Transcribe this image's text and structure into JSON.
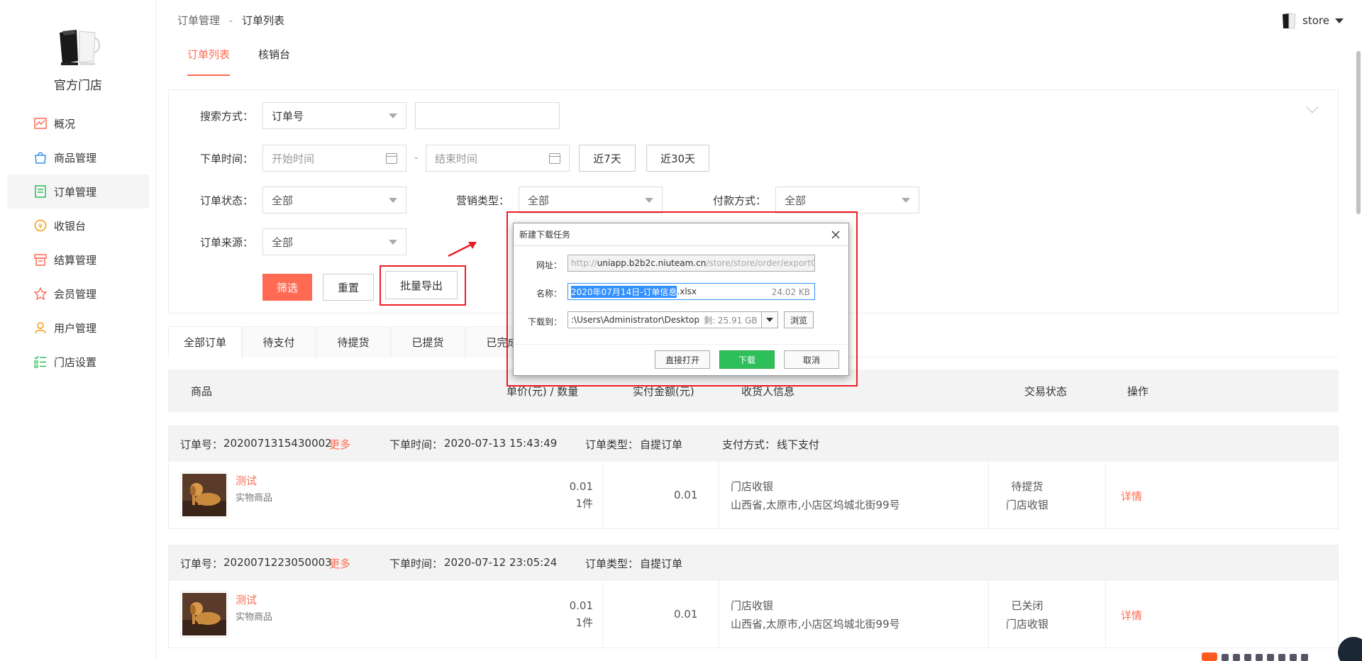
{
  "store": {
    "name": "官方门店"
  },
  "nav": {
    "items": [
      {
        "label": "概况",
        "icon": "chart-icon"
      },
      {
        "label": "商品管理",
        "icon": "bag-icon"
      },
      {
        "label": "订单管理",
        "icon": "order-icon"
      },
      {
        "label": "收银台",
        "icon": "cashier-icon"
      },
      {
        "label": "结算管理",
        "icon": "settlement-icon"
      },
      {
        "label": "会员管理",
        "icon": "member-icon"
      },
      {
        "label": "用户管理",
        "icon": "user-icon"
      },
      {
        "label": "门店设置",
        "icon": "settings-list-icon"
      }
    ],
    "active_index": 2
  },
  "breadcrumb": {
    "parent": "订单管理",
    "separator": "-",
    "current": "订单列表"
  },
  "user": {
    "name": "store"
  },
  "main_tabs": [
    {
      "label": "订单列表"
    },
    {
      "label": "核销台"
    }
  ],
  "filters": {
    "search_mode_label": "搜索方式：",
    "search_mode_value": "订单号",
    "search_input_value": "",
    "order_time_label": "下单时间：",
    "start_placeholder": "开始时间",
    "range_sep": "-",
    "end_placeholder": "结束时间",
    "last7": "近7天",
    "last30": "近30天",
    "order_status_label": "订单状态：",
    "order_status_value": "全部",
    "marketing_label": "营销类型：",
    "marketing_value": "全部",
    "payment_label": "付款方式：",
    "payment_value": "全部",
    "source_label": "订单来源：",
    "source_value": "全部",
    "filter_btn": "筛选",
    "reset_btn": "重置",
    "export_btn": "批量导出"
  },
  "status_tabs": [
    "全部订单",
    "待支付",
    "待提货",
    "已提货",
    "已完成"
  ],
  "table_header": {
    "goods": "商品",
    "unit_qty": "单价(元) / 数量",
    "paid": "实付金额(元)",
    "receiver": "收货人信息",
    "status": "交易状态",
    "action": "操作"
  },
  "orders": [
    {
      "order_no_label": "订单号：",
      "order_no": "2020071315430002",
      "more": "更多",
      "time_label": "下单时间：",
      "time": "2020-07-13 15:43:49",
      "type_label": "订单类型：",
      "type": "自提订单",
      "pay_label": "支付方式：",
      "pay": "线下支付",
      "goods_name": "测试",
      "goods_type": "实物商品",
      "price": "0.01",
      "qty": "1件",
      "paid": "0.01",
      "receiver_name": "门店收银",
      "receiver_address": "山西省,太原市,小店区坞城北街99号",
      "status": "待提货",
      "status_sub": "门店收银",
      "detail": "详情"
    },
    {
      "order_no_label": "订单号：",
      "order_no": "2020071223050003",
      "more": "更多",
      "time_label": "下单时间：",
      "time": "2020-07-12 23:05:24",
      "type_label": "订单类型：",
      "type": "自提订单",
      "goods_name": "测试",
      "goods_type": "实物商品",
      "price": "0.01",
      "qty": "1件",
      "paid": "0.01",
      "receiver_name": "门店收银",
      "receiver_address": "山西省,太原市,小店区坞城北街99号",
      "status": "已关闭",
      "status_sub": "门店收银",
      "detail": "详情"
    }
  ],
  "download_dialog": {
    "title": "新建下载任务",
    "url_label": "网址：",
    "url_prefix": "http://",
    "url_host": "uniapp.b2b2c.niuteam.cn",
    "url_path": "/store/store/order/exportO",
    "name_label": "名称：",
    "name_selected": "2020年07月14日-订单信息",
    "name_ext": ".xlsx",
    "size": "24.02 KB",
    "dest_label": "下载到：",
    "dest_path": ":\\Users\\Administrator\\Desktop",
    "free_space": "剩: 25.91 GB",
    "browse": "浏览",
    "open_directly": "直接打开",
    "download": "下载",
    "cancel": "取消"
  },
  "colors": {
    "accent": "#ff6a52",
    "highlight": "#ee1c25",
    "download_green": "#2ebf5b"
  }
}
